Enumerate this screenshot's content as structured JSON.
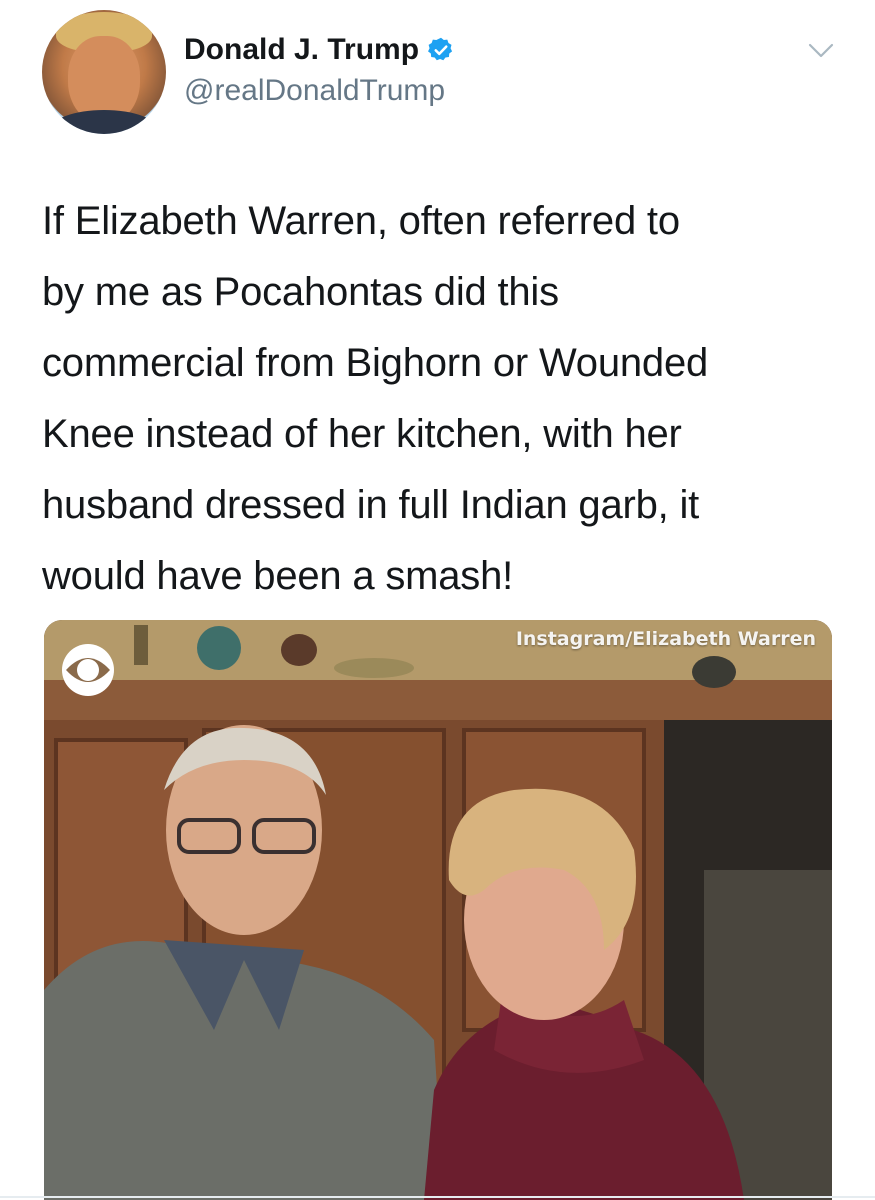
{
  "tweet": {
    "author_name": "Donald J. Trump",
    "author_handle": "@realDonaldTrump",
    "text": "If Elizabeth Warren, often referred to\nby me as Pocahontas did this\ncommercial from Bighorn or Wounded\nKnee instead of her kitchen, with her\nhusband dressed in full Indian garb, it\nwould have been a smash!",
    "verified": true,
    "menu_icon": "chevron-down-icon"
  },
  "media": {
    "watermark": "Instagram/Elizabeth Warren",
    "logo_icon": "cbs-eye-logo"
  },
  "colors": {
    "verified_blue": "#1da1f2",
    "handle_gray": "#657786",
    "text": "#14171a"
  }
}
